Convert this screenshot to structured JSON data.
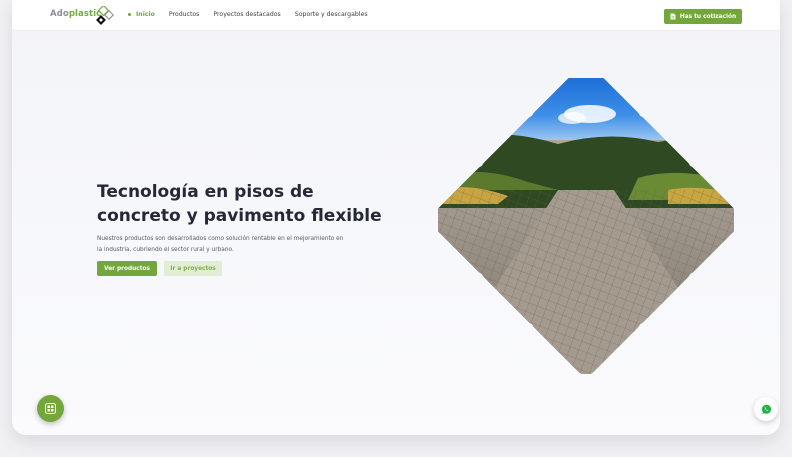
{
  "header": {
    "logo": {
      "part1": "Ado",
      "part2": "plastic"
    },
    "nav": [
      {
        "label": "Inicio",
        "active": true
      },
      {
        "label": "Productos",
        "active": false
      },
      {
        "label": "Proyectos destacados",
        "active": false
      },
      {
        "label": "Soporte y descargables",
        "active": false
      }
    ],
    "cta_label": "Has tu cotización"
  },
  "hero": {
    "title_line1": "Tecnología en pisos de",
    "title_line2": "concreto y pavimento flexible",
    "desc_line1": "Nuestros productos son desarrollados como solución rentable en el mejoramiento en",
    "desc_line2": "la industria, cubriendo el sector rural y urbano.",
    "primary_label": "Ver productos",
    "secondary_label": "Ir a proyectos"
  },
  "floating": {
    "left_icon": "grid-menu-icon",
    "right_icon": "whatsapp-icon"
  },
  "colors": {
    "brand_green": "#73a63b",
    "brand_green_light": "#e1eed3",
    "title_dark": "#252836",
    "page_bg": "#f3f4f8"
  }
}
